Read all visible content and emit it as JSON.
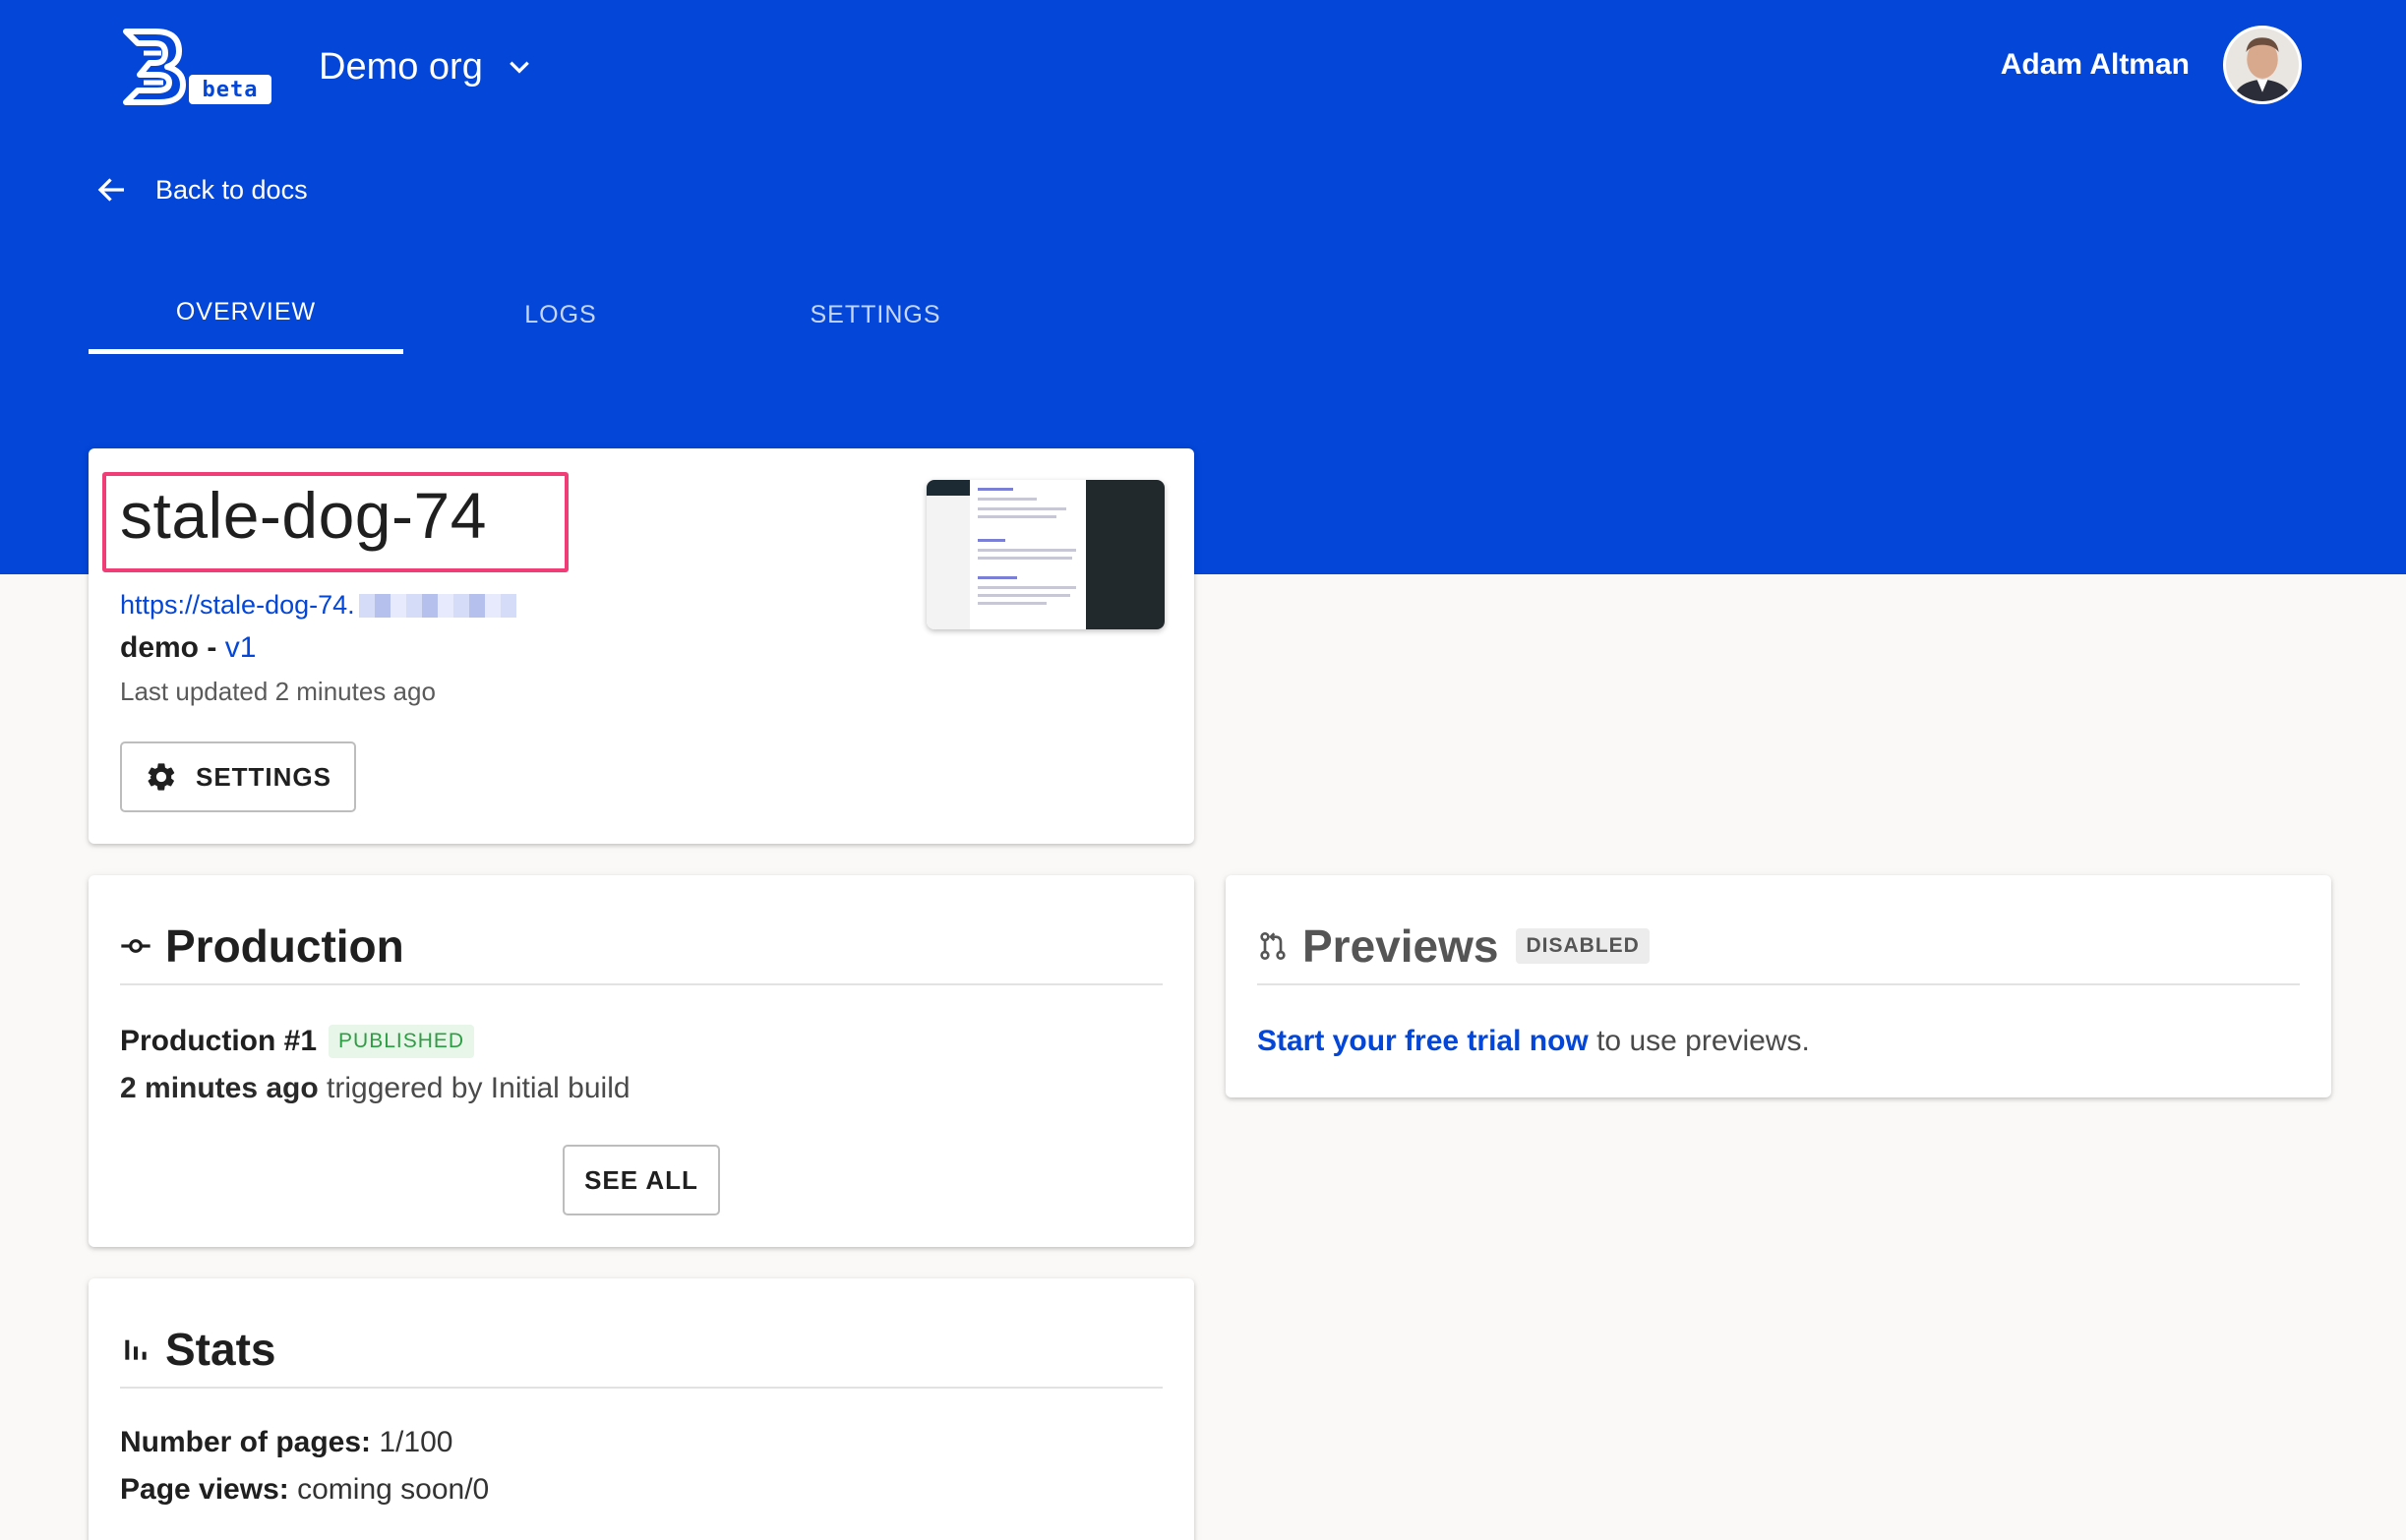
{
  "header": {
    "org_name": "Demo org",
    "beta_label": "beta",
    "user_name": "Adam Altman",
    "back_label": "Back to docs"
  },
  "tabs": [
    {
      "label": "OVERVIEW",
      "active": true
    },
    {
      "label": "LOGS",
      "active": false
    },
    {
      "label": "SETTINGS",
      "active": false
    }
  ],
  "project": {
    "title": "stale-dog-74",
    "url": "https://stale-dog-74.",
    "name": "demo",
    "separator": " - ",
    "version": "v1",
    "updated": "Last updated 2 minutes ago",
    "settings_label": "SETTINGS"
  },
  "production": {
    "title": "Production",
    "build_name": "Production #1",
    "status": "PUBLISHED",
    "time": "2 minutes ago",
    "trigger": " triggered by Initial build",
    "see_all_label": "SEE ALL"
  },
  "previews": {
    "title": "Previews",
    "status": "DISABLED",
    "cta_link": "Start your free trial now",
    "cta_rest": " to use previews."
  },
  "stats": {
    "title": "Stats",
    "pages_label": "Number of pages:",
    "pages_value": " 1/100",
    "views_label": "Page views:",
    "views_value": " coming soon/0"
  },
  "colors": {
    "brand": "#0346d8",
    "highlight": "#f03d78",
    "published": "#2e9e44",
    "page_bg": "#fbf9f7"
  },
  "icons": [
    "logo-icon",
    "chevron-down-icon",
    "arrow-left-icon",
    "gear-icon",
    "commit-icon",
    "pull-request-icon",
    "bar-chart-icon"
  ]
}
